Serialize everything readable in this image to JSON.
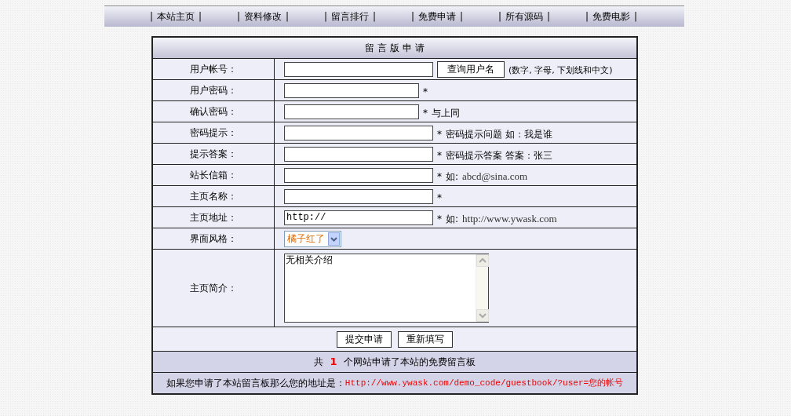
{
  "nav": [
    {
      "left": "|",
      "label": "本站主页",
      "right": "|"
    },
    {
      "left": "|",
      "label": "资料修改",
      "right": "|"
    },
    {
      "left": "|",
      "label": "留言排行",
      "right": "|"
    },
    {
      "left": "|",
      "label": "免费申请",
      "right": "|"
    },
    {
      "left": "|",
      "label": "所有源码",
      "right": "|"
    },
    {
      "left": "|",
      "label": "免费电影",
      "right": "|"
    }
  ],
  "form": {
    "title": "留 言 版 申 请",
    "rows": [
      {
        "label": "用户帐号：",
        "kind": "text",
        "button": "查询用户名",
        "note": "(数字, 字母, 下划线和中文)"
      },
      {
        "label": "用户密码：",
        "kind": "password",
        "mark": "*"
      },
      {
        "label": "确认密码：",
        "kind": "password",
        "mark": "*",
        "note": "与上同"
      },
      {
        "label": "密码提示：",
        "kind": "text",
        "mark": "*",
        "note": "密码提示问题 如：我是谁"
      },
      {
        "label": "提示答案：",
        "kind": "text",
        "mark": "*",
        "note": "密码提示答案 答案：张三"
      },
      {
        "label": "站长信箱：",
        "kind": "text",
        "mark": "*",
        "note": "如:",
        "example": "abcd@sina.com"
      },
      {
        "label": "主页名称：",
        "kind": "text",
        "mark": "*"
      },
      {
        "label": "主页地址：",
        "kind": "text",
        "value": "http://",
        "mark": "*",
        "note": "如:",
        "example": "http://www.ywask.com"
      },
      {
        "label": "界面风格：",
        "kind": "select",
        "value": "橘子红了"
      },
      {
        "label": "主页简介：",
        "kind": "textarea",
        "value": "无相关介绍"
      }
    ],
    "buttons": [
      "提交申请",
      "重新填写"
    ],
    "stats": {
      "prefix": "共",
      "count": "1",
      "suffix": "个网站申请了本站的免费留言板"
    },
    "address": {
      "text": "如果您申请了本站留言板那么您的地址是：",
      "url": "Http://www.ywask.com/demo_code/guestbook/?user=您的帐号"
    }
  }
}
